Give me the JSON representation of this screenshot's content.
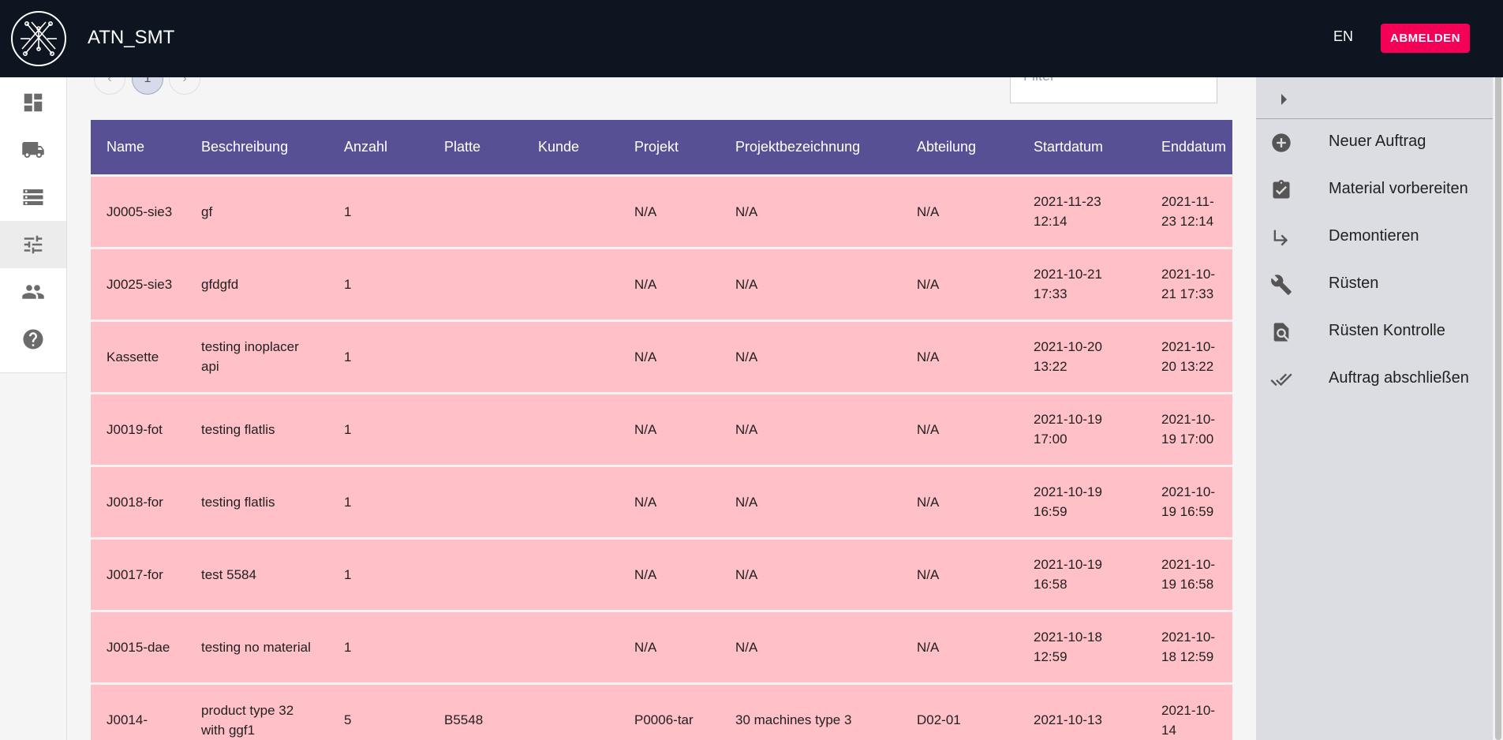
{
  "app": {
    "title": "ATN_SMT",
    "logo": "circuit-logo"
  },
  "header": {
    "language": "EN",
    "logout_label": "ABMELDEN"
  },
  "sidebar": {
    "items": [
      {
        "name": "dashboard",
        "icon": "dashboard-icon"
      },
      {
        "name": "shipping",
        "icon": "truck-icon"
      },
      {
        "name": "storage",
        "icon": "storage-icon"
      },
      {
        "name": "settings",
        "icon": "tune-icon",
        "active": true
      },
      {
        "name": "users",
        "icon": "people-icon"
      },
      {
        "name": "help",
        "icon": "help-icon"
      }
    ]
  },
  "pagination": {
    "prev": "‹",
    "current": "1",
    "next": "›"
  },
  "filter": {
    "placeholder": "Filter"
  },
  "table": {
    "columns": [
      "Name",
      "Beschreibung",
      "Anzahl",
      "Platte",
      "Kunde",
      "Projekt",
      "Projektbezeichnung",
      "Abteilung",
      "Startdatum",
      "Enddatum"
    ],
    "rows": [
      [
        "J0005-sie3",
        "gf",
        "1",
        "",
        "",
        "N/A",
        "N/A",
        "N/A",
        "2021-11-23 12:14",
        "2021-11-23 12:14"
      ],
      [
        "J0025-sie3",
        "gfdgfd",
        "1",
        "",
        "",
        "N/A",
        "N/A",
        "N/A",
        "2021-10-21 17:33",
        "2021-10-21 17:33"
      ],
      [
        "Kassette",
        "testing inoplacer api",
        "1",
        "",
        "",
        "N/A",
        "N/A",
        "N/A",
        "2021-10-20 13:22",
        "2021-10-20 13:22"
      ],
      [
        "J0019-fot",
        "testing flatlis",
        "1",
        "",
        "",
        "N/A",
        "N/A",
        "N/A",
        "2021-10-19 17:00",
        "2021-10-19 17:00"
      ],
      [
        "J0018-for",
        "testing flatlis",
        "1",
        "",
        "",
        "N/A",
        "N/A",
        "N/A",
        "2021-10-19 16:59",
        "2021-10-19 16:59"
      ],
      [
        "J0017-for",
        "test 5584",
        "1",
        "",
        "",
        "N/A",
        "N/A",
        "N/A",
        "2021-10-19 16:58",
        "2021-10-19 16:58"
      ],
      [
        "J0015-dae",
        "testing no material",
        "1",
        "",
        "",
        "N/A",
        "N/A",
        "N/A",
        "2021-10-18 12:59",
        "2021-10-18 12:59"
      ],
      [
        "J0014-",
        "product type 32 with ggf1",
        "5",
        "B5548",
        "",
        "P0006-tar",
        "30 machines type 3",
        "D02-01",
        "2021-10-13",
        "2021-10-14"
      ]
    ]
  },
  "actions": [
    {
      "label": "Neuer Auftrag",
      "icon": "add-circle-icon"
    },
    {
      "label": "Material vorbereiten",
      "icon": "clipboard-check-icon"
    },
    {
      "label": "Demontieren",
      "icon": "subdirectory-arrow-icon"
    },
    {
      "label": "Rüsten",
      "icon": "wrench-icon"
    },
    {
      "label": "Rüsten Kontrolle",
      "icon": "find-in-page-icon"
    },
    {
      "label": "Auftrag abschließen",
      "icon": "done-all-icon"
    }
  ],
  "colors": {
    "header_bg": "#0d1620",
    "logout": "#f50057",
    "table_header": "#575094",
    "row_bg": "#ffc0c8",
    "panel_bg": "#dcdde3"
  }
}
